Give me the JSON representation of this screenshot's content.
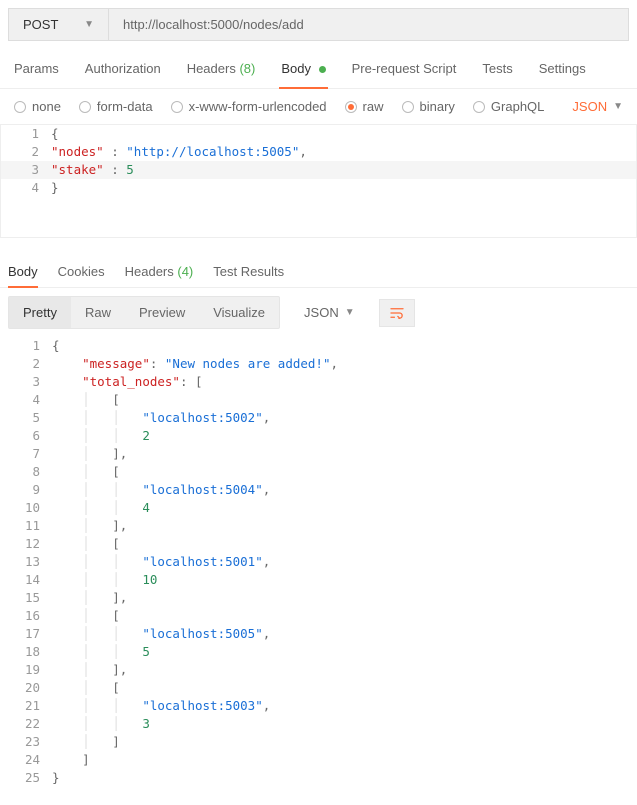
{
  "request": {
    "method": "POST",
    "url": "http://localhost:5000/nodes/add"
  },
  "tabs": {
    "params": "Params",
    "authorization": "Authorization",
    "headers": "Headers",
    "headers_count": "(8)",
    "body": "Body",
    "prerequest": "Pre-request Script",
    "tests": "Tests",
    "settings": "Settings"
  },
  "body_types": {
    "none": "none",
    "formdata": "form-data",
    "xform": "x-www-form-urlencoded",
    "raw": "raw",
    "binary": "binary",
    "graphql": "GraphQL",
    "json_label": "JSON"
  },
  "request_body": {
    "l1": "{",
    "l2_key": "\"nodes\"",
    "l2_sep": " : ",
    "l2_val": "\"http://localhost:5005\"",
    "l2_tail": ",",
    "l3_key": "\"stake\"",
    "l3_sep": " : ",
    "l3_val": "5",
    "l4": "}"
  },
  "resp_tabs": {
    "body": "Body",
    "cookies": "Cookies",
    "headers": "Headers",
    "headers_count": "(4)",
    "test_results": "Test Results"
  },
  "resp_toolbar": {
    "pretty": "Pretty",
    "raw": "Raw",
    "preview": "Preview",
    "visualize": "Visualize",
    "json": "JSON"
  },
  "response": {
    "k_message": "\"message\"",
    "v_message": "\"New nodes are added!\"",
    "k_total_nodes": "\"total_nodes\"",
    "nodes": [
      {
        "host": "\"localhost:5002\"",
        "val": "2"
      },
      {
        "host": "\"localhost:5004\"",
        "val": "4"
      },
      {
        "host": "\"localhost:5001\"",
        "val": "10"
      },
      {
        "host": "\"localhost:5005\"",
        "val": "5"
      },
      {
        "host": "\"localhost:5003\"",
        "val": "3"
      }
    ]
  }
}
